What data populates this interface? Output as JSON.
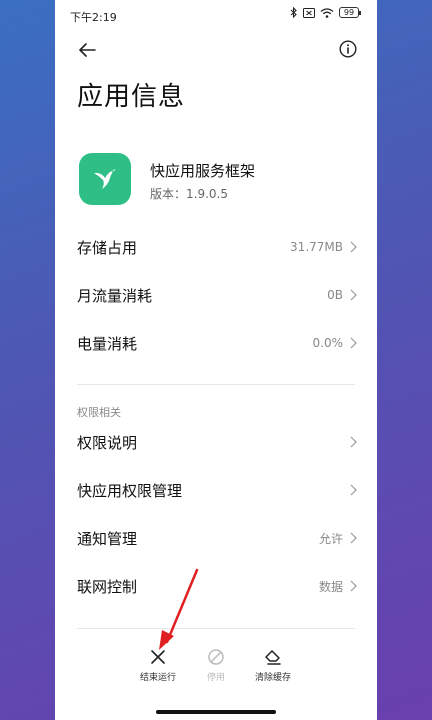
{
  "status_bar": {
    "time": "下午2:19",
    "battery": "99"
  },
  "page": {
    "title": "应用信息"
  },
  "app": {
    "name": "快应用服务框架",
    "version": "版本：1.9.0.5"
  },
  "rows": [
    {
      "label": "存储占用",
      "value": "31.77MB"
    },
    {
      "label": "月流量消耗",
      "value": "0B"
    },
    {
      "label": "电量消耗",
      "value": "0.0%"
    }
  ],
  "permissions_section": {
    "title": "权限相关",
    "rows": [
      {
        "label": "权限说明",
        "value": ""
      },
      {
        "label": "快应用权限管理",
        "value": ""
      },
      {
        "label": "通知管理",
        "value": "允许"
      },
      {
        "label": "联网控制",
        "value": "数据"
      }
    ]
  },
  "bottom_actions": {
    "force_stop": "结束运行",
    "disable": "停用",
    "clear_cache": "清除缓存"
  },
  "colors": {
    "app_icon": "#2fbf86",
    "annotation_arrow": "#e02020"
  }
}
